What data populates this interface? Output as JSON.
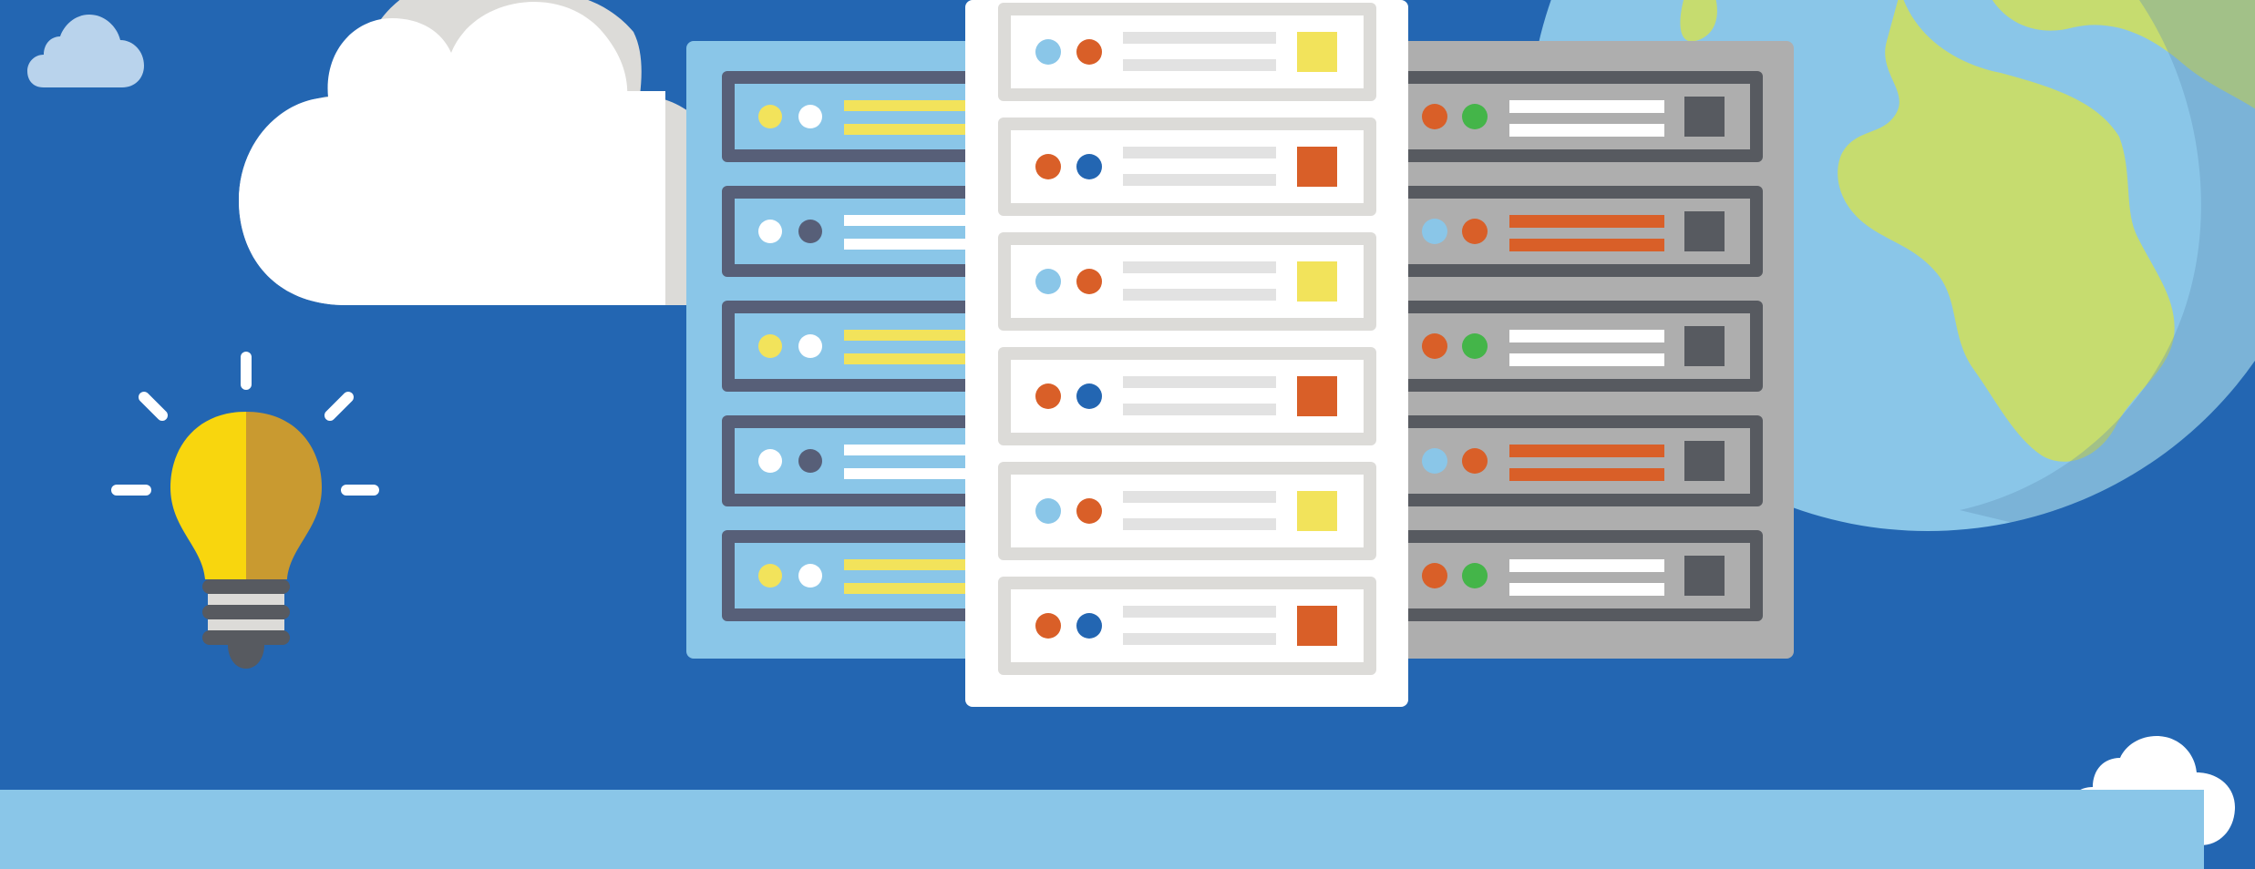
{
  "scene": {
    "subject": "cloud-hosting-server-illustration",
    "colors": {
      "background": "#2366b2",
      "ground": "#8ac6e8",
      "cloud": "#ffffff",
      "cloud_shadow": "#dcdbd8",
      "small_cloud": "#b9d3ec",
      "globe_ocean": "#8ac6e8",
      "globe_land": "#c6dc6f",
      "globe_shade": "#7aaed0",
      "bulb_yellow": "#f8d60e",
      "bulb_gold": "#c99a30",
      "bulb_base": "#575a60",
      "rack_left": "#8ac6e8",
      "rack_middle": "#ffffff",
      "rack_right": "#aeaeae",
      "led_yellow": "#f2e35b",
      "led_orange": "#d95f28",
      "led_blue": "#2366b2",
      "led_light_blue": "#8ac6e8",
      "led_green": "#44b549",
      "led_slate": "#575f78"
    },
    "icons": [
      "lightbulb-icon",
      "cloud-icon",
      "globe-icon",
      "server-rack-icon"
    ],
    "racks": [
      {
        "name": "left-rack",
        "units": [
          {
            "led1": "yellow",
            "led2": "white",
            "bars": "yellow"
          },
          {
            "led1": "white",
            "led2": "slate",
            "bars": "white"
          },
          {
            "led1": "yellow",
            "led2": "white",
            "bars": "yellow"
          },
          {
            "led1": "white",
            "led2": "slate",
            "bars": "white"
          },
          {
            "led1": "yellow",
            "led2": "white",
            "bars": "yellow"
          }
        ]
      },
      {
        "name": "middle-rack",
        "units": [
          {
            "led1": "light_blue",
            "led2": "orange",
            "indicator": "yellow"
          },
          {
            "led1": "orange",
            "led2": "blue",
            "indicator": "orange"
          },
          {
            "led1": "light_blue",
            "led2": "orange",
            "indicator": "yellow"
          },
          {
            "led1": "orange",
            "led2": "blue",
            "indicator": "orange"
          },
          {
            "led1": "light_blue",
            "led2": "orange",
            "indicator": "yellow"
          },
          {
            "led1": "orange",
            "led2": "blue",
            "indicator": "orange"
          }
        ]
      },
      {
        "name": "right-rack",
        "units": [
          {
            "led1": "orange",
            "led2": "green",
            "bars": "white"
          },
          {
            "led1": "light_blue",
            "led2": "orange",
            "bars": "orange"
          },
          {
            "led1": "orange",
            "led2": "green",
            "bars": "white"
          },
          {
            "led1": "light_blue",
            "led2": "orange",
            "bars": "orange"
          },
          {
            "led1": "orange",
            "led2": "green",
            "bars": "white"
          }
        ]
      }
    ]
  }
}
